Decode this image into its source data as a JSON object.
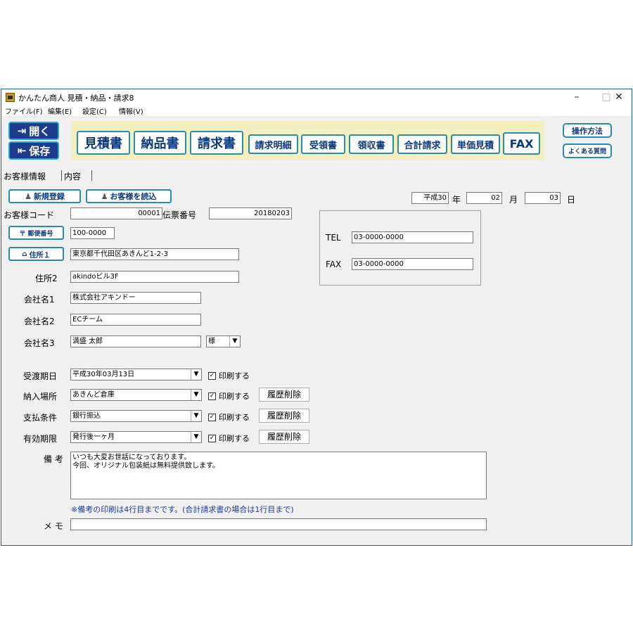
{
  "window": {
    "title": "かんたん商人 見積・納品・請求8",
    "controls": {
      "minimize": "–",
      "maximize": "□",
      "close": "✕"
    }
  },
  "menu": [
    "ファイル(F)",
    "編集(E)",
    "設定(C)",
    "情報(V)"
  ],
  "toolbar": {
    "open_label": "開く",
    "save_label": "保存",
    "doc_buttons": [
      "見積書",
      "納品書",
      "請求書",
      "請求明細",
      "受領書",
      "領収書",
      "合計請求",
      "単価見積",
      "FAX"
    ],
    "help_label": "操作方法",
    "faq_label": "よくある質問"
  },
  "tabs": [
    "お客様情報",
    "内容"
  ],
  "customer": {
    "new_button": "新規登録",
    "load_button": "お客様を読込",
    "date": {
      "era": "平成30",
      "year_label": "年",
      "month": "02",
      "month_label": "月",
      "day": "03",
      "day_label": "日"
    },
    "code_label": "お客様コード",
    "code_value": "00001",
    "slip_label": "伝票番号",
    "slip_value": "20180203",
    "zip_button": "郵便番号",
    "zip_value": "100-0000",
    "addr1_button": "住所１",
    "addr1_value": "東京都千代田区あきんど1-2-3",
    "addr2_label": "住所2",
    "addr2_value": "akindoビル3F",
    "company1_label": "会社名1",
    "company1_value": "株式会社アキンドー",
    "company2_label": "会社名2",
    "company2_value": "ECチーム",
    "company3_label": "会社名3",
    "company3_value": "満盛  太郎",
    "honorific": "様",
    "tel_label": "TEL",
    "tel_value": "03-0000-0000",
    "fax_label": "FAX",
    "fax_value": "03-0000-0000"
  },
  "conditions": {
    "print_label": "印刷する",
    "delete_label": "履歴削除",
    "rows": [
      {
        "label": "受渡期日",
        "value": "平成30年03月13日"
      },
      {
        "label": "納入場所",
        "value": "あきんど倉庫"
      },
      {
        "label": "支払条件",
        "value": "銀行振込"
      },
      {
        "label": "有効期限",
        "value": "発行後一ヶ月"
      }
    ]
  },
  "remarks": {
    "label": "備  考",
    "line1": "いつも大変お世話になっております。",
    "line2": "今回、オリジナル包装紙は無料提供致します。",
    "note": "※備考の印刷は4行目までです。(合計請求書の場合は1行目まで)"
  },
  "memo": {
    "label": "メ  モ",
    "value": ""
  },
  "icons": [
    "open-icon",
    "save-icon",
    "person-icon",
    "postal-icon",
    "house-icon",
    "dropdown-arrow-icon",
    "checkbox-icon"
  ]
}
